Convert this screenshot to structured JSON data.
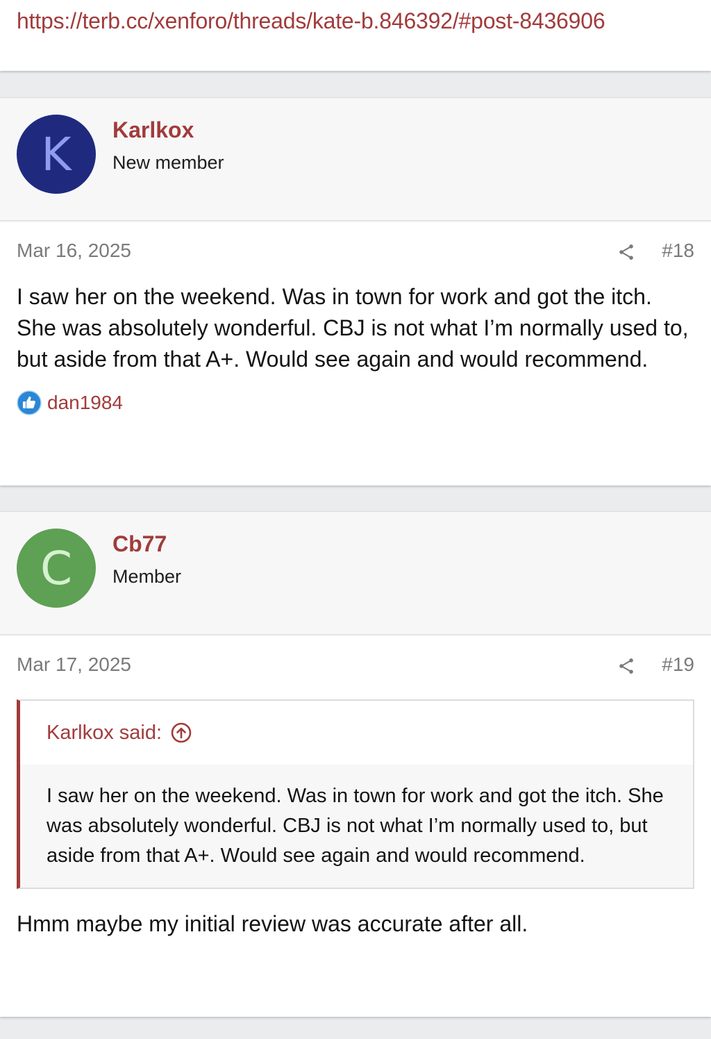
{
  "url": {
    "text": "https://terb.cc/xenforo/threads/kate-b.846392/#post-8436906"
  },
  "posts": [
    {
      "avatar_letter": "K",
      "avatar_bg": "#1f2a7f",
      "avatar_fg": "#8f9cf0",
      "username": "Karlkox",
      "user_title": "New member",
      "date": "Mar 16, 2025",
      "share_icon": "share-icon",
      "number": "#18",
      "body": "I saw her on the weekend. Was in town for work and got the itch. She was absolutely wonderful. CBJ is not what I’m normally used to, but aside from that A+. Would see again and would recommend.",
      "reaction_icon": "thumbs-up-icon",
      "reaction_user": "dan1984"
    },
    {
      "avatar_letter": "C",
      "avatar_bg": "#5ea054",
      "avatar_fg": "#d4f2cf",
      "username": "Cb77",
      "user_title": "Member",
      "date": "Mar 17, 2025",
      "share_icon": "share-icon",
      "number": "#19",
      "quote": {
        "author": "Karlkox said:",
        "arrow_icon": "circle-arrow-up-icon",
        "text": "I saw her on the weekend. Was in town for work and got the itch. She was absolutely wonderful. CBJ is not what I’m normally used to, but aside from that A+. Would see again and would recommend."
      },
      "body": "Hmm maybe my initial review was accurate after all."
    }
  ],
  "colors": {
    "link": "#a23b3b",
    "page_bg": "#ebecee",
    "meta_text": "#7a7a7a",
    "like_blue": "#2b87d6"
  }
}
